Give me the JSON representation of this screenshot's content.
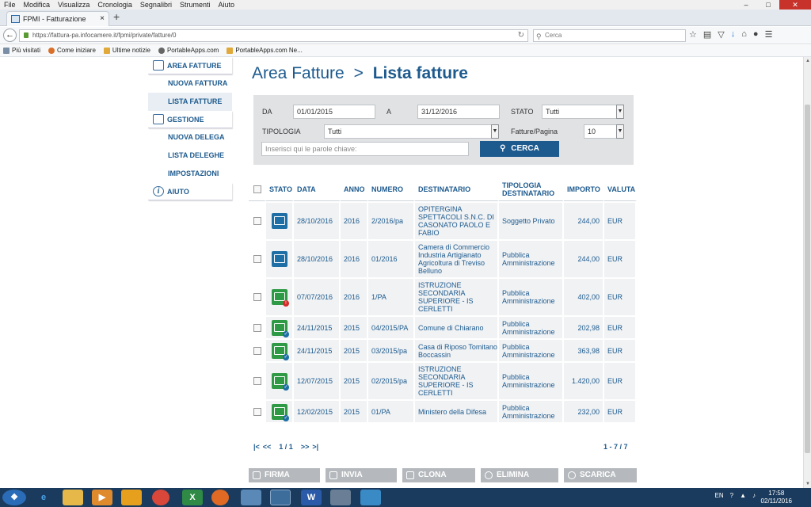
{
  "browser": {
    "menu": [
      "File",
      "Modifica",
      "Visualizza",
      "Cronologia",
      "Segnalibri",
      "Strumenti",
      "Aiuto"
    ],
    "tab_title": "FPMI - Fatturazione elettro...",
    "url": "https://fattura-pa.infocamere.it/fpmi/private/fatture/0",
    "search_placeholder": "Cerca",
    "bookmarks": [
      "Più visitati",
      "Come iniziare",
      "Ultime notizie",
      "PortableApps.com",
      "PortableApps.com Ne..."
    ]
  },
  "sidebar": {
    "area_fatture": "AREA FATTURE",
    "nuova_fattura": "NUOVA FATTURA",
    "lista_fatture": "LISTA FATTURE",
    "gestione": "GESTIONE",
    "nuova_delega": "NUOVA DELEGA",
    "lista_deleghe": "LISTA DELEGHE",
    "impostazioni": "IMPOSTAZIONI",
    "aiuto": "AIUTO"
  },
  "page": {
    "title_area": "Area Fatture",
    "title_sep": ">",
    "title_page": "Lista fatture"
  },
  "filter": {
    "da_label": "DA",
    "da_value": "01/01/2015",
    "a_label": "A",
    "a_value": "31/12/2016",
    "stato_label": "STATO",
    "stato_value": "Tutti",
    "tipologia_label": "TIPOLOGIA",
    "tipologia_value": "Tutti",
    "per_page_label": "Fatture/Pagina",
    "per_page_value": "10",
    "keywords_placeholder": "Inserisci qui le parole chiave:",
    "search_button": "CERCA"
  },
  "table": {
    "headers": {
      "stato": "STATO",
      "data": "DATA",
      "anno": "ANNO",
      "numero": "NUMERO",
      "destinatario": "DESTINATARIO",
      "tipologia": "TIPOLOGIA DESTINATARIO",
      "importo": "IMPORTO",
      "valuta": "VALUTA"
    },
    "rows": [
      {
        "status": "blue",
        "data": "28/10/2016",
        "anno": "2016",
        "numero": "2/2016/pa",
        "destinatario": "OPITERGINA SPETTACOLI S.N.C. DI CASONATO PAOLO E FABIO",
        "tipologia": "Soggetto Privato",
        "importo": "244,00",
        "valuta": "EUR"
      },
      {
        "status": "blue",
        "data": "28/10/2016",
        "anno": "2016",
        "numero": "01/2016",
        "destinatario": "Camera di Commercio Industria Artigianato Agricoltura di Treviso Belluno",
        "tipologia": "Pubblica Amministrazione",
        "importo": "244,00",
        "valuta": "EUR"
      },
      {
        "status": "warn",
        "data": "07/07/2016",
        "anno": "2016",
        "numero": "1/PA",
        "destinatario": "ISTRUZIONE SECONDARIA SUPERIORE - IS CERLETTI",
        "tipologia": "Pubblica Amministrazione",
        "importo": "402,00",
        "valuta": "EUR"
      },
      {
        "status": "ok",
        "data": "24/11/2015",
        "anno": "2015",
        "numero": "04/2015/PA",
        "destinatario": "Comune di Chiarano",
        "tipologia": "Pubblica Amministrazione",
        "importo": "202,98",
        "valuta": "EUR"
      },
      {
        "status": "ok",
        "data": "24/11/2015",
        "anno": "2015",
        "numero": "03/2015/pa",
        "destinatario": "Casa di Riposo Tomitano Boccassin",
        "tipologia": "Pubblica Amministrazione",
        "importo": "363,98",
        "valuta": "EUR"
      },
      {
        "status": "ok",
        "data": "12/07/2015",
        "anno": "2015",
        "numero": "02/2015/pa",
        "destinatario": "ISTRUZIONE SECONDARIA SUPERIORE - IS CERLETTI",
        "tipologia": "Pubblica Amministrazione",
        "importo": "1.420,00",
        "valuta": "EUR"
      },
      {
        "status": "ok",
        "data": "12/02/2015",
        "anno": "2015",
        "numero": "01/PA",
        "destinatario": "Ministero della Difesa",
        "tipologia": "Pubblica Amministrazione",
        "importo": "232,00",
        "valuta": "EUR"
      }
    ]
  },
  "pager": {
    "first": "|<",
    "prev": "<<",
    "pages": "1 / 1",
    "next": ">>",
    "last": ">|",
    "count": "1 - 7 / 7"
  },
  "actions": {
    "firma": "FIRMA",
    "invia": "INVIA",
    "clona": "CLONA",
    "elimina": "ELIMINA",
    "scarica": "SCARICA"
  },
  "taskbar": {
    "lang": "EN",
    "time": "17:58",
    "date": "02/11/2016"
  },
  "colors": {
    "brand": "#1d5a8e",
    "status_blue": "#1d6fa5",
    "status_green": "#2f9a45",
    "status_warn": "#d62b2b"
  }
}
